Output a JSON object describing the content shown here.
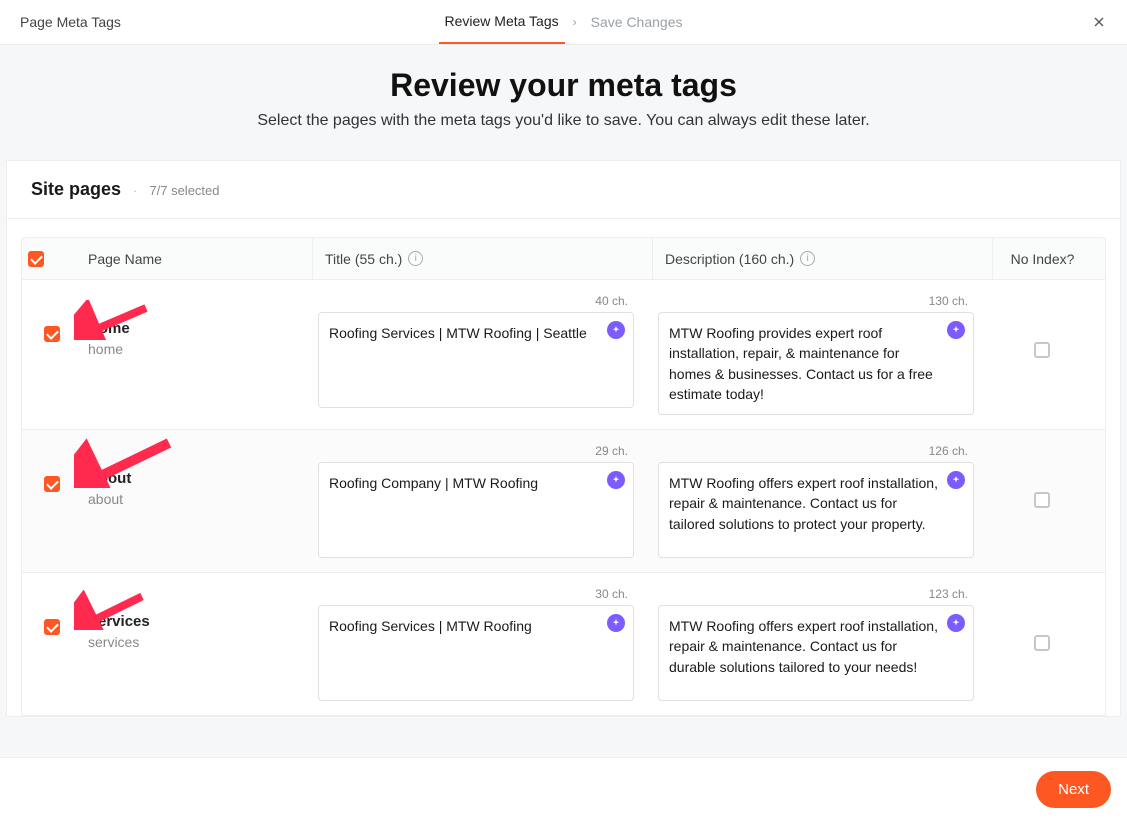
{
  "topbar": {
    "title": "Page Meta Tags",
    "breadcrumb_active": "Review Meta Tags",
    "breadcrumb_next": "Save Changes"
  },
  "hero": {
    "heading": "Review your meta tags",
    "sub": "Select the pages with the meta tags you'd like to save. You can always edit these later."
  },
  "card": {
    "title": "Site pages",
    "selected": "7/7 selected"
  },
  "columns": {
    "page_name": "Page Name",
    "title": "Title (55 ch.)",
    "description": "Description (160 ch.)",
    "no_index": "No Index?"
  },
  "rows": [
    {
      "name": "Home",
      "slug": "home",
      "title_count": "40 ch.",
      "title": "Roofing Services | MTW Roofing | Seattle",
      "desc_count": "130 ch.",
      "desc": "MTW Roofing provides expert roof installation, repair, & maintenance for homes & businesses. Contact us for a free estimate today!"
    },
    {
      "name": "About",
      "slug": "about",
      "title_count": "29 ch.",
      "title": "Roofing Company | MTW Roofing",
      "desc_count": "126 ch.",
      "desc": "MTW Roofing offers expert roof installation, repair & maintenance. Contact us for tailored solutions to protect your property."
    },
    {
      "name": "Services",
      "slug": "services",
      "title_count": "30 ch.",
      "title": "Roofing Services | MTW Roofing",
      "desc_count": "123 ch.",
      "desc": "MTW Roofing offers expert roof installation, repair & maintenance. Contact us for durable solutions tailored to your needs!"
    }
  ],
  "footer": {
    "next": "Next"
  }
}
